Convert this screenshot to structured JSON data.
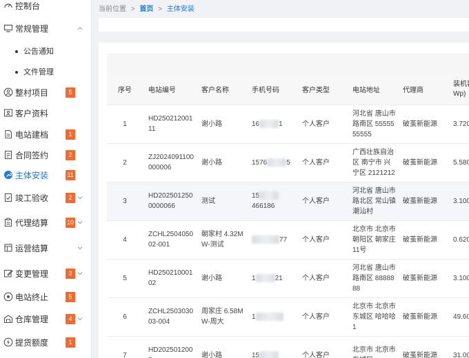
{
  "sidebar": {
    "top_item": "控制台",
    "group_regular": "常规管理",
    "sub_items": [
      "公告通知",
      "文件管理"
    ],
    "items": [
      {
        "label": "整村项目",
        "badge": "5",
        "icon": "user-circle-icon"
      },
      {
        "label": "客户资料",
        "badge": "",
        "icon": "user-icon"
      },
      {
        "label": "电站建档",
        "badge": "1",
        "icon": "file-icon"
      },
      {
        "label": "合同签约",
        "badge": "2",
        "icon": "document-icon"
      },
      {
        "label": "主体安装",
        "badge": "11",
        "icon": "wrench-icon"
      },
      {
        "label": "竣工验收",
        "badge": "2",
        "icon": "check-doc-icon"
      },
      {
        "label": "代理结算",
        "badge": "10",
        "icon": "clipboard-icon"
      },
      {
        "label": "运营结算",
        "badge": "",
        "icon": "box-icon"
      },
      {
        "label": "变更管理",
        "badge": "3",
        "icon": "edit-icon"
      },
      {
        "label": "电站终止",
        "badge": "5",
        "icon": "location-icon"
      },
      {
        "label": "仓库管理",
        "badge": "4",
        "icon": "warehouse-icon"
      },
      {
        "label": "提货额度",
        "badge": "1",
        "icon": "lightning-icon"
      }
    ]
  },
  "breadcrumb": {
    "prefix": "当前位置",
    "sep": ">",
    "home": "首页",
    "current": "主体安装"
  },
  "table": {
    "headers": [
      "序号",
      "电站编号",
      "客户名称",
      "手机号码",
      "客户类型",
      "电站地址",
      "代理商",
      "装机容量(KWp)"
    ],
    "rows": [
      {
        "no": "1",
        "code": "HD25021200111",
        "name": "谢小路",
        "phone_a": "16",
        "phone_b": "1",
        "type": "个人客户",
        "address": "河北省 唐山市 路南区 5555555555",
        "agent": "破茧新能源",
        "capacity": "3.720"
      },
      {
        "no": "2",
        "code": "ZJ2024091100000006",
        "name": "谢小路",
        "phone_a": "1576",
        "phone_b": "5",
        "type": "个人客户",
        "address": "广西壮族自治区 南宁市 兴宁区 2121212",
        "agent": "破茧新能源",
        "capacity": "5.580"
      },
      {
        "no": "3",
        "code": "HD2025012500000066",
        "name": "测试",
        "phone_a": "15",
        "phone_b": "466186",
        "type": "个人客户",
        "address": "河北省 唐山市 路北区 常山镇 潮汕村",
        "agent": "破茧新能源",
        "capacity": "3.100"
      },
      {
        "no": "4",
        "code": "ZCHL250405002-001",
        "name": "朝家村 4.32MW-测试",
        "phone_a": "",
        "phone_b": "77",
        "type": "个人客户",
        "address": "北京市 北京市 朝阳区 朝家庄 11号",
        "agent": "破茧新能源",
        "capacity": "0.620"
      },
      {
        "no": "5",
        "code": "HD25021000102",
        "name": "谢小路",
        "phone_a": "1",
        "phone_b": "21",
        "type": "个人客户",
        "address": "河北省 唐山市 路南区 8888888",
        "agent": "破茧新能源",
        "capacity": "3.100"
      },
      {
        "no": "6",
        "code": "ZCHL250303003-004",
        "name": "周家庄 6.58MW-周大",
        "phone_a": "1",
        "phone_b": "",
        "type": "个人客户",
        "address": "北京市 北京市 东城区 哈哈哈 1",
        "agent": "破茧新能源",
        "capacity": "49.60"
      },
      {
        "no": "7",
        "code": "HD2025012002",
        "name": "谢小路",
        "phone_a": "15",
        "phone_b": "",
        "type": "个人客户",
        "address": "北京市 北京市 东城区",
        "agent": "破茧新能源",
        "capacity": "31.00"
      }
    ]
  },
  "colors": {
    "accent": "#1f7ae0",
    "badge": "#f26a2e"
  }
}
